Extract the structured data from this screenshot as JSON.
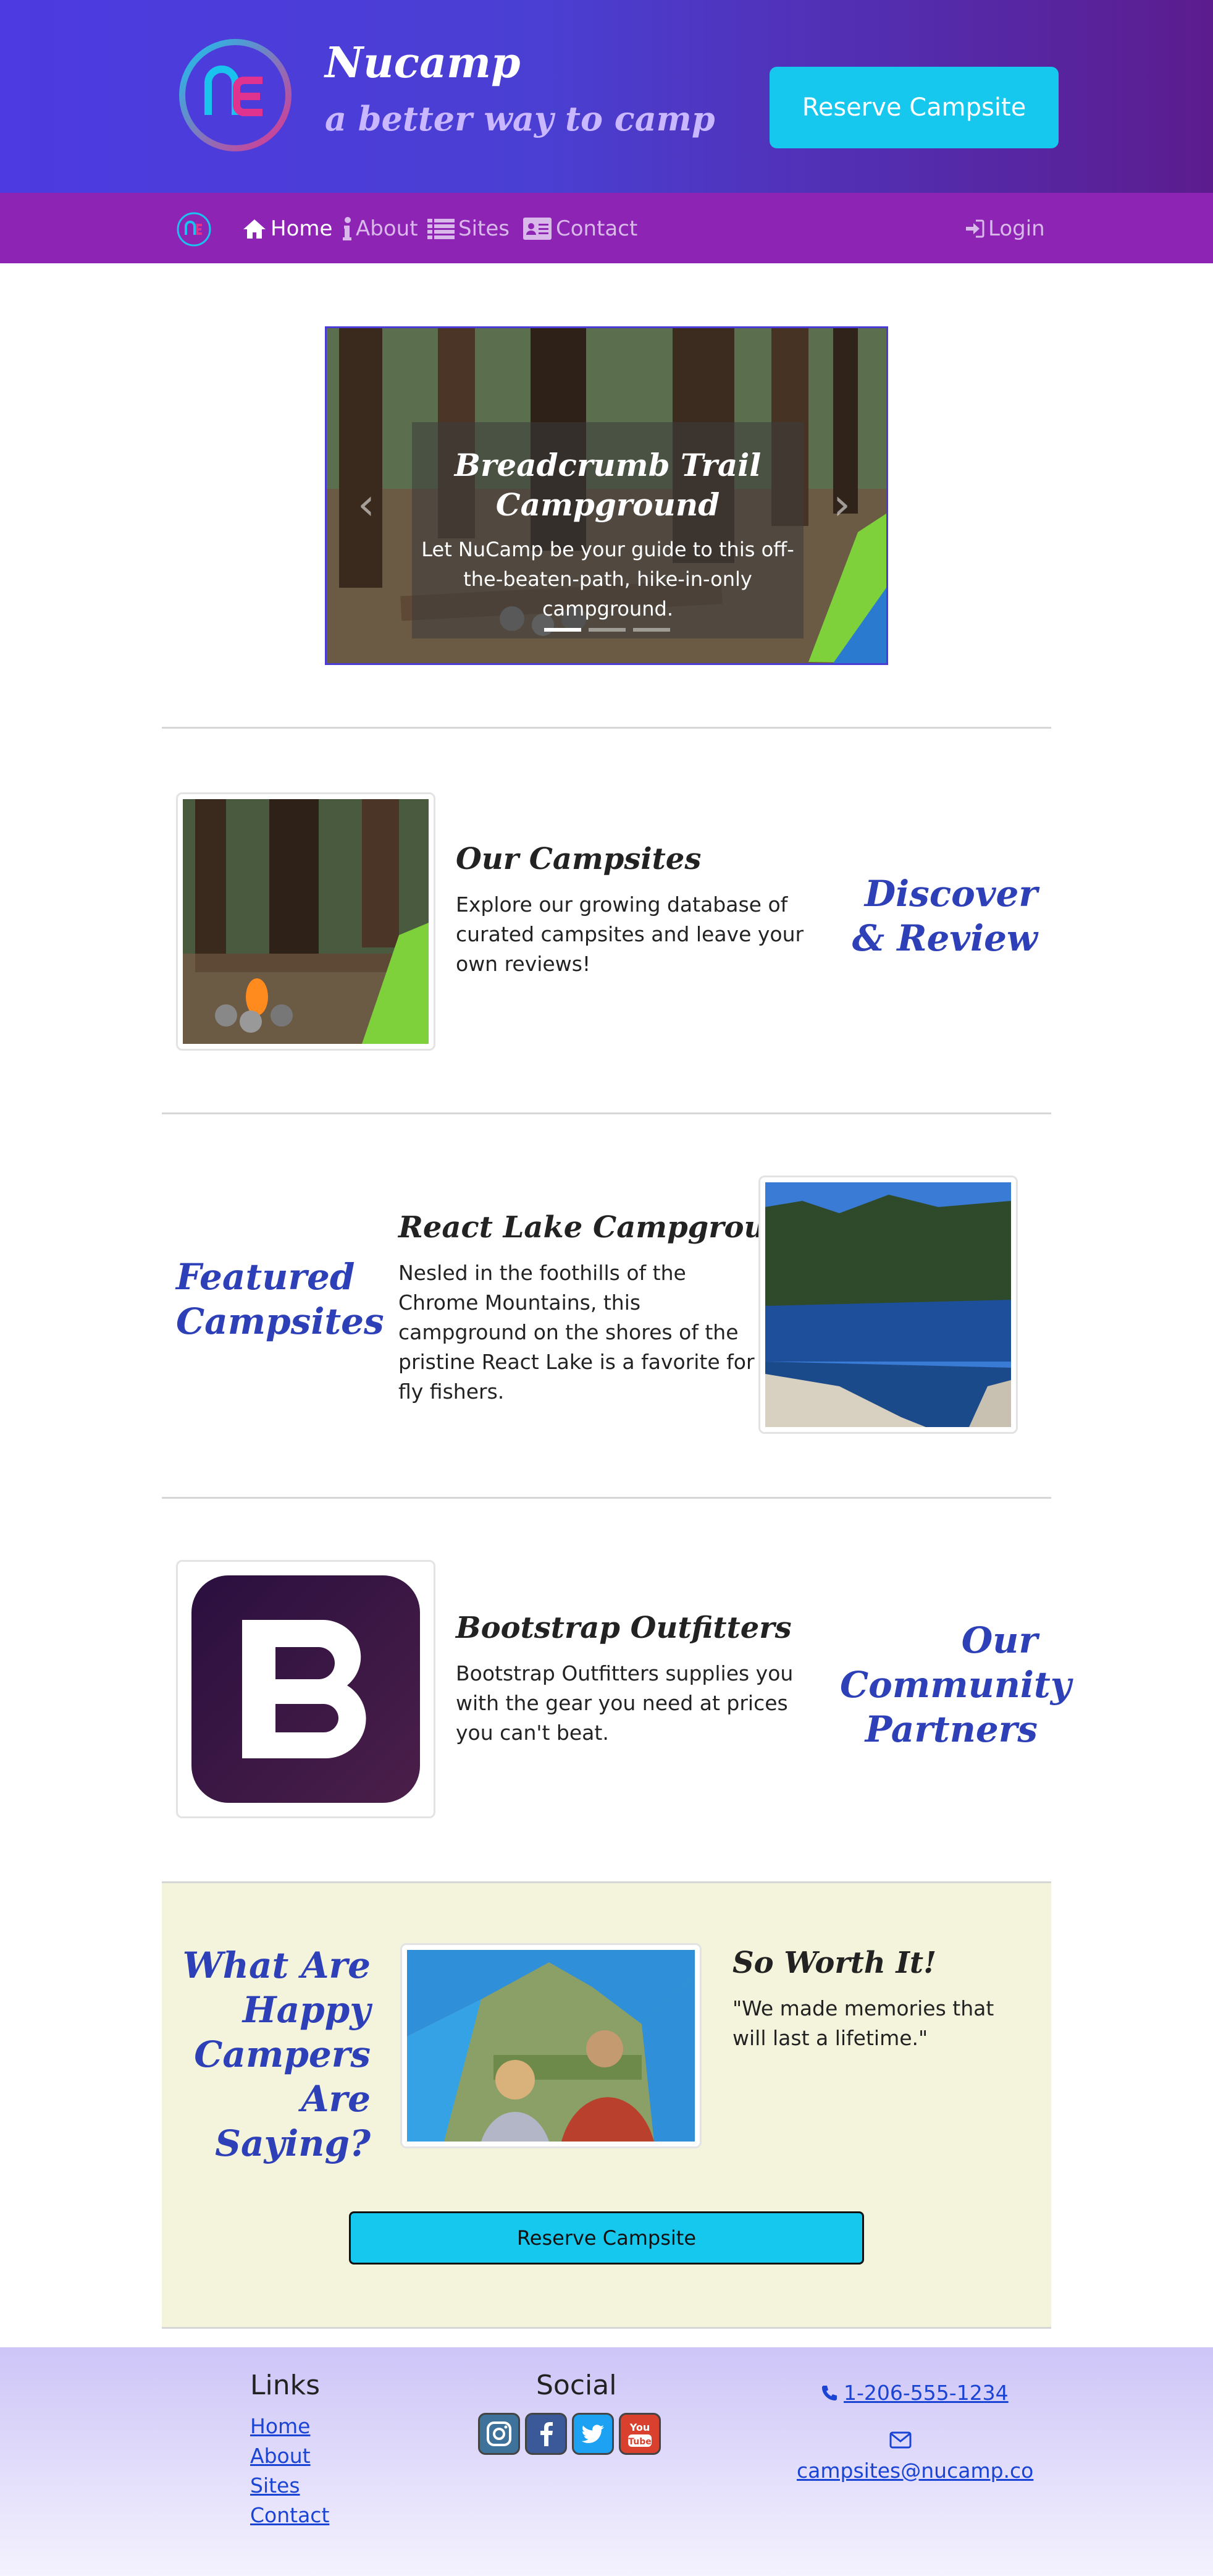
{
  "header": {
    "brand_name": "Nucamp",
    "tagline": "a better way to camp",
    "reserve_label": "Reserve Campsite"
  },
  "nav": {
    "items": [
      {
        "label": "Home",
        "icon": "home-icon",
        "active": true
      },
      {
        "label": "About",
        "icon": "info-icon",
        "active": false
      },
      {
        "label": "Sites",
        "icon": "list-icon",
        "active": false
      },
      {
        "label": "Contact",
        "icon": "address-card-icon",
        "active": false
      }
    ],
    "login_label": "Login"
  },
  "carousel": {
    "title": "Breadcrumb Trail Campground",
    "text": "Let NuCamp be your guide to this off-the-beaten-path, hike-in-only campground.",
    "slides": 3,
    "active_slide": 1
  },
  "sections": {
    "campsites": {
      "label": "Discover & Review",
      "title": "Our Campsites",
      "text": "Explore our growing database of curated campsites and leave your own reviews!"
    },
    "featured": {
      "label": "Featured Campsites",
      "title": "React Lake Campground",
      "text": "Nesled in the foothills of the Chrome Mountains, this campground on the shores of the pristine React Lake is a favorite for fly fishers."
    },
    "partners": {
      "label": "Our Community Partners",
      "title": "Bootstrap Outfitters",
      "text": "Bootstrap Outfitters supplies you with the gear you need at prices you can't beat."
    }
  },
  "testimonials": {
    "label": "What Are Happy Campers Are Saying?",
    "title": "So Worth It!",
    "quote": "\"We made memories that will last a lifetime.\"",
    "reserve_label": "Reserve Campsite"
  },
  "footer": {
    "links_heading": "Links",
    "links": [
      "Home",
      "About",
      "Sites",
      "Contact"
    ],
    "social_heading": "Social",
    "social_icons": [
      "instagram-icon",
      "facebook-icon",
      "twitter-icon",
      "youtube-icon"
    ],
    "phone": "1-206-555-1234",
    "email": "campsites@nucamp.co"
  },
  "colors": {
    "header_start": "#4d3ae0",
    "header_end": "#5c1c8e",
    "nav": "#8e24b4",
    "accent": "#17c8ee",
    "heading_blue": "#2e40b8",
    "testimonial_bg": "#f4f4dc"
  }
}
